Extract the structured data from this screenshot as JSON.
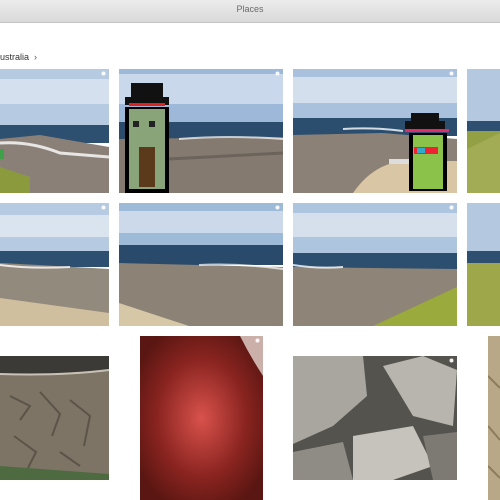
{
  "window": {
    "title": "Places"
  },
  "breadcrumb": {
    "label": "ustralia",
    "chevron": "›"
  },
  "icons": {
    "chevron": "chevron-right-icon",
    "pin": "location-pin-icon"
  },
  "colors": {
    "titlebar": "#dcdcdc",
    "title_text": "#6b6b6b",
    "sky": "#b9cde3",
    "ocean": "#2f4f6f",
    "rock": "#8b7f73",
    "grass": "#8d9a3e"
  },
  "photos": [
    {
      "row": 1,
      "subject": "coastline"
    },
    {
      "row": 1,
      "subject": "coastline"
    },
    {
      "row": 1,
      "subject": "coastline"
    },
    {
      "row": 1,
      "subject": "grass"
    },
    {
      "row": 2,
      "subject": "coastline"
    },
    {
      "row": 2,
      "subject": "coastline"
    },
    {
      "row": 2,
      "subject": "coastline"
    },
    {
      "row": 2,
      "subject": "grass"
    },
    {
      "row": 3,
      "subject": "rock"
    },
    {
      "row": 3,
      "subject": "blurred red"
    },
    {
      "row": 3,
      "subject": "boulders"
    },
    {
      "row": 3,
      "subject": "sand"
    }
  ]
}
